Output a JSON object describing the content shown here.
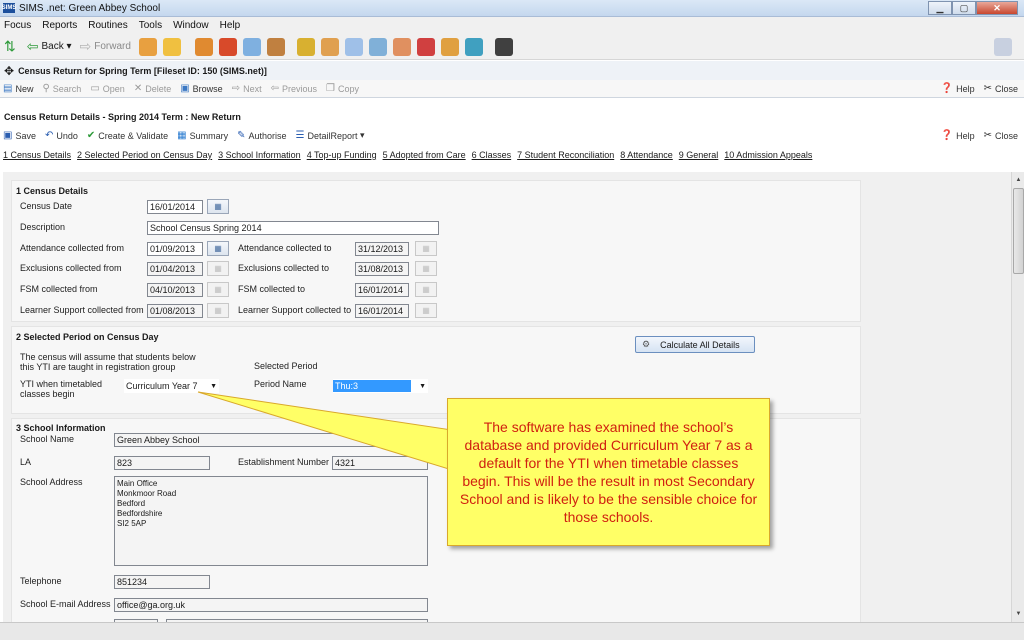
{
  "window": {
    "title": "SIMS .net: Green Abbey School",
    "app_icon": "SIMS"
  },
  "menu": [
    "Focus",
    "Reports",
    "Routines",
    "Tools",
    "Window",
    "Help"
  ],
  "nav_toolbar": {
    "back": "Back",
    "forward": "Forward"
  },
  "page": {
    "title": "Census Return for Spring Term [Fileset ID: 150 (SIMS.net)]",
    "actions": [
      "New",
      "Search",
      "Open",
      "Delete",
      "Browse",
      "Next",
      "Previous",
      "Copy"
    ],
    "help": "Help",
    "close": "Close"
  },
  "census_return": {
    "title": "Census Return Details - Spring 2014 Term : New Return",
    "actions": [
      "Save",
      "Undo",
      "Create & Validate",
      "Summary",
      "Authorise",
      "DetailReport"
    ],
    "help": "Help",
    "close": "Close",
    "tabs": [
      "1 Census Details",
      "2 Selected Period on Census Day",
      "3 School Information",
      "4 Top-up Funding",
      "5 Adopted from Care",
      "6 Classes",
      "7 Student Reconciliation",
      "8 Attendance",
      "9 General",
      "10 Admission Appeals"
    ]
  },
  "census_details": {
    "section_title": "1 Census Details",
    "census_date_label": "Census Date",
    "census_date": "16/01/2014",
    "description_label": "Description",
    "description": "School Census Spring 2014",
    "attendance_from_label": "Attendance collected from",
    "attendance_from": "01/09/2013",
    "attendance_to_label": "Attendance collected to",
    "attendance_to": "31/12/2013",
    "exclusions_from_label": "Exclusions collected from",
    "exclusions_from": "01/04/2013",
    "exclusions_to_label": "Exclusions collected to",
    "exclusions_to": "31/08/2013",
    "fsm_from_label": "FSM collected from",
    "fsm_from": "04/10/2013",
    "fsm_to_label": "FSM collected to",
    "fsm_to": "16/01/2014",
    "learner_from_label": "Learner Support collected from",
    "learner_from": "01/08/2013",
    "learner_to_label": "Learner Support collected to",
    "learner_to": "16/01/2014"
  },
  "selected_period": {
    "section_title": "2 Selected Period on Census Day",
    "note": "The census will assume that students below this YTI are taught in registration group",
    "selected_period_label": "Selected Period",
    "yti_label": "YTI when timetabled classes begin",
    "yti_value": "Curriculum Year  7",
    "period_name_label": "Period Name",
    "period_name": "Thu:3",
    "calculate_button": "Calculate All Details"
  },
  "school_info": {
    "section_title": "3 School Information",
    "school_name_label": "School Name",
    "school_name": "Green Abbey School",
    "la_label": "LA",
    "la": "823",
    "establishment_label": "Establishment Number",
    "establishment_number": "4321",
    "address_label": "School Address",
    "address_lines": [
      "Main Office",
      "Monkmoor Road",
      "Bedford",
      "Bedfordshire",
      "SI2 5AP"
    ],
    "telephone_label": "Telephone",
    "telephone": "851234",
    "email_label": "School E-mail Address",
    "email": "office@ga.org.uk"
  },
  "callout": {
    "text": "The software has examined the school’s database and provided Curriculum Year 7 as a default for the YTI when timetable classes begin.  This will be the result in most Secondary School and is likely to be the sensible choice for those schools."
  },
  "colors": {
    "callout_fill": "#ffff66",
    "callout_text": "#d02010",
    "selection": "#3399ff"
  }
}
